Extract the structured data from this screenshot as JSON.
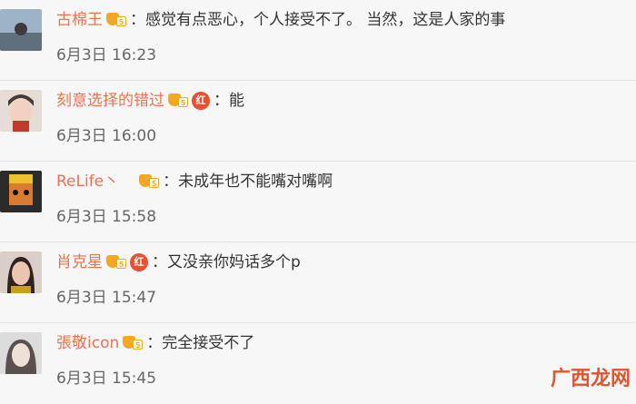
{
  "comments": [
    {
      "username": "古棉王",
      "badges": {
        "vip": "5",
        "hong": ""
      },
      "text": "感觉有点恶心，个人接受不了。 当然，这是人家的事",
      "time": "6月3日 16:23"
    },
    {
      "username": "刻意选择的错过",
      "badges": {
        "vip": "5",
        "hong": "红"
      },
      "text": "能",
      "time": "6月3日 16:00"
    },
    {
      "username": "ReLife丶",
      "badges": {
        "vip": "5",
        "hong": ""
      },
      "text": "未成年也不能嘴对嘴啊",
      "time": "6月3日 15:58"
    },
    {
      "username": "肖克星",
      "badges": {
        "vip": "5",
        "hong": "红"
      },
      "text": "又没亲你妈话多个p",
      "time": "6月3日 15:47"
    },
    {
      "username": "張敬icon",
      "badges": {
        "vip": "5",
        "hong": ""
      },
      "text": "完全接受不了",
      "time": "6月3日 15:45"
    }
  ],
  "watermark": {
    "text": "广西龙网"
  },
  "colors": {
    "username": "#eb7350",
    "text": "#333333",
    "time": "#666666",
    "vip": "#f5a623",
    "hong": "#e8502f"
  }
}
